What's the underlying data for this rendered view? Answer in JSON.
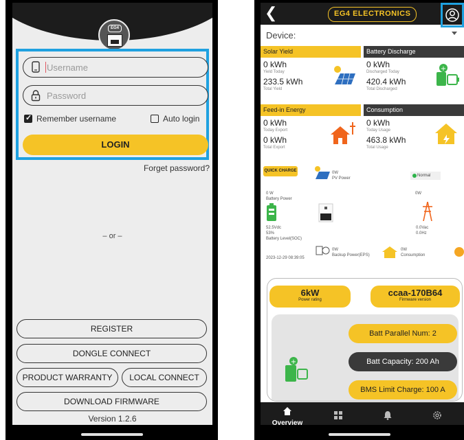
{
  "login": {
    "username_placeholder": "Username",
    "password_placeholder": "Password",
    "remember_label": "Remember username",
    "remember_checked": true,
    "auto_login_label": "Auto login",
    "auto_login_checked": false,
    "login_button": "LOGIN",
    "forget_password": "Forget password?",
    "or_divider": "– or –",
    "register_button": "REGISTER",
    "dongle_button": "DONGLE CONNECT",
    "warranty_button": "PRODUCT WARRANTY",
    "local_button": "LOCAL CONNECT",
    "firmware_button": "DOWNLOAD FIRMWARE",
    "version": "Version 1.2.6",
    "logo_badge": "EG4"
  },
  "overview": {
    "brand": "EG4 ELECTRONICS",
    "device_label": "Device:",
    "cards": {
      "solar": {
        "title": "Solar Yield",
        "v1": "0 kWh",
        "l1": "Yield Today",
        "v2": "233.5 kWh",
        "l2": "Total Yield"
      },
      "battery": {
        "title": "Battery Discharge",
        "v1": "0 kWh",
        "l1": "Discharged Today",
        "v2": "420.4 kWh",
        "l2": "Total Discharged"
      },
      "feedin": {
        "title": "Feed-in Energy",
        "v1": "0 kWh",
        "l1": "Today Export",
        "v2": "0 kWh",
        "l2": "Total Export"
      },
      "consumption": {
        "title": "Consumption",
        "v1": "0 kWh",
        "l1": "Today Usage",
        "v2": "463.8 kWh",
        "l2": "Total Usage"
      }
    },
    "flow": {
      "quick_charge": "QUICK CHARGE",
      "pv_value": "0W",
      "pv_label": "PV Power",
      "status": "Normal",
      "battery_power_value": "0 W",
      "battery_power_label": "Battery Power",
      "grid_value": "0W",
      "battery_voltage": "52.5Vdc",
      "battery_soc": "53%",
      "battery_level_label": "Battery Level(SOC)",
      "grid_voltage": "0.0Vac",
      "grid_freq": "0.0Hz",
      "timestamp": "2023-12-29 08:39:05",
      "eps_value": "0W",
      "eps_label": "Backup Power(EPS)",
      "consumption_value": "0W",
      "consumption_label": "Consumption"
    },
    "info": {
      "power_rating": "6kW",
      "power_rating_label": "Power rating",
      "firmware": "ccaa-170B64",
      "firmware_label": "Firmware version",
      "parallel": "Batt Parallel Num: 2",
      "capacity": "Batt Capacity: 200 Ah",
      "bms_limit": "BMS Limit Charge: 100 A"
    },
    "nav": {
      "overview": "Overview"
    },
    "colors": {
      "accent": "#f5c326",
      "highlight": "#1fa1e0",
      "dark": "#1c1c1c"
    }
  }
}
